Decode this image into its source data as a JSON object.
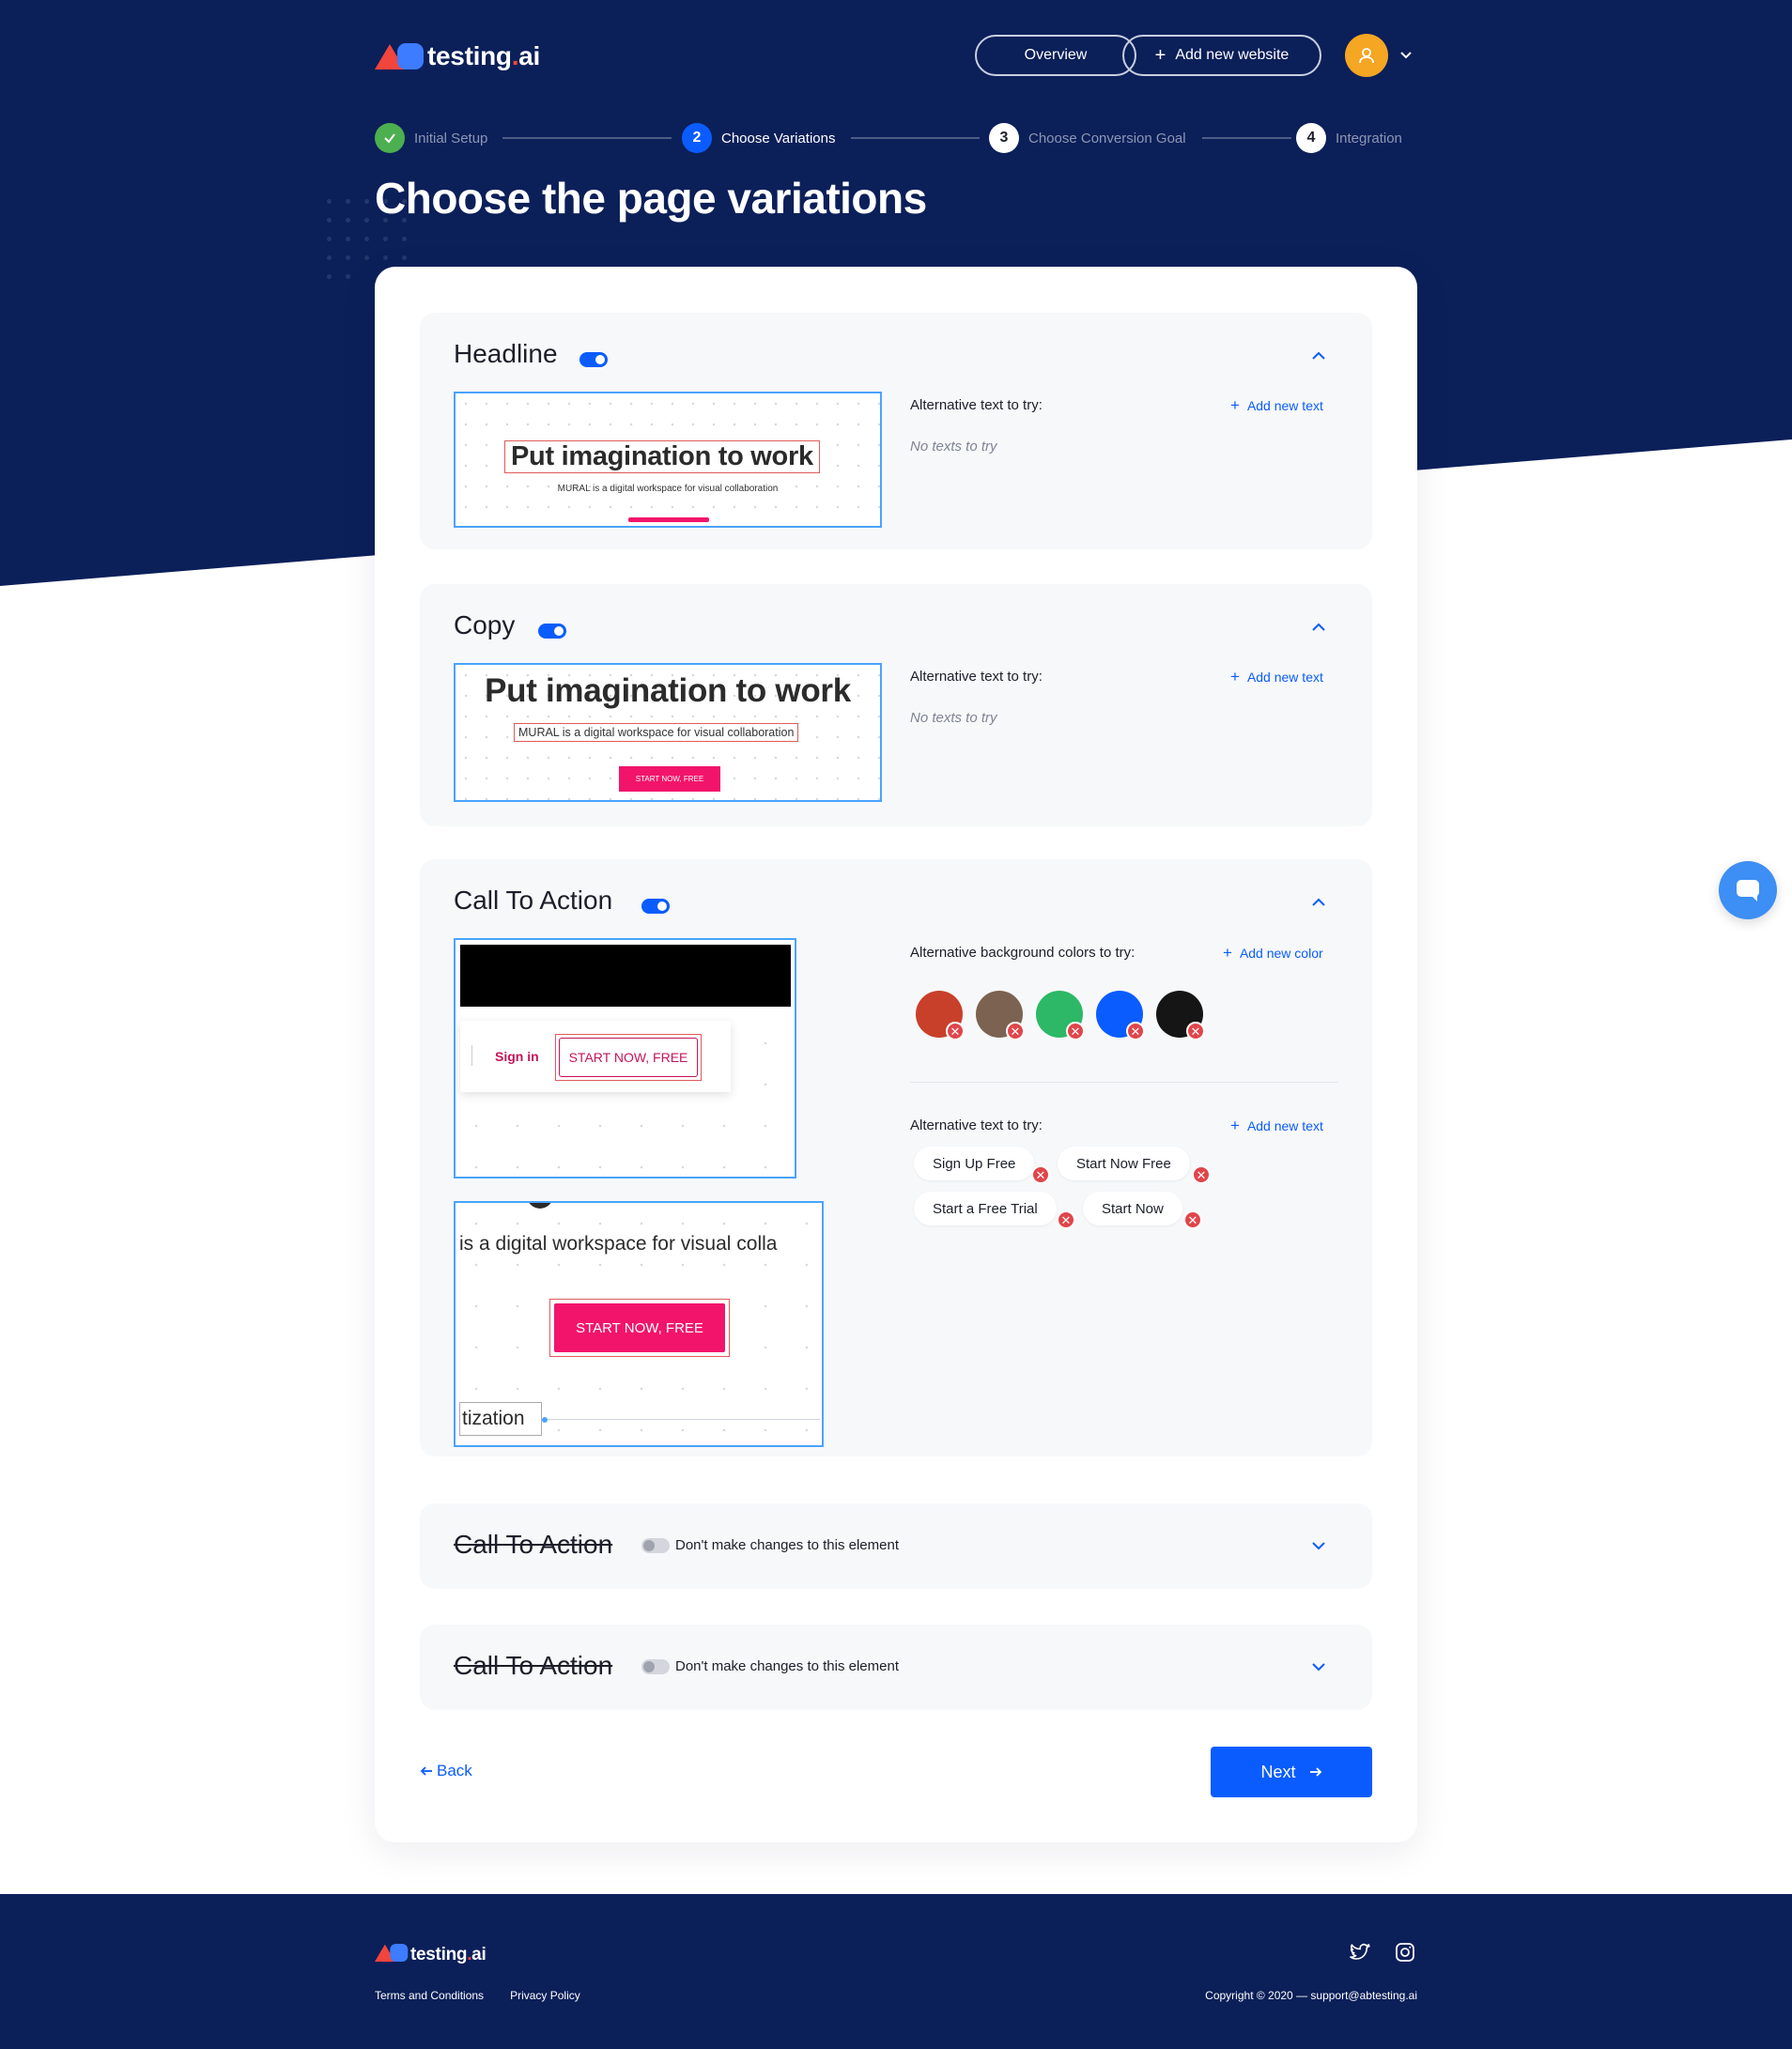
{
  "header": {
    "logo_text": "testing",
    "logo_dot": ".",
    "logo_suffix": "ai",
    "overview_label": "Overview",
    "add_website_label": "Add new website"
  },
  "stepper": {
    "steps": [
      {
        "number": "",
        "label": "Initial Setup",
        "state": "done"
      },
      {
        "number": "2",
        "label": "Choose Variations",
        "state": "active"
      },
      {
        "number": "3",
        "label": "Choose Conversion Goal",
        "state": "pending"
      },
      {
        "number": "4",
        "label": "Integration",
        "state": "pending"
      }
    ]
  },
  "page_title": "Choose the page variations",
  "sections": {
    "headline": {
      "title": "Headline",
      "enabled": true,
      "preview_heading": "Put imagination to work",
      "preview_sub": "MURAL is a digital workspace for visual collaboration",
      "alt_label": "Alternative text to try:",
      "add_label": "Add new text",
      "empty_label": "No texts to try"
    },
    "copy": {
      "title": "Copy",
      "enabled": true,
      "preview_heading": "Put imagination to work",
      "preview_sub": "MURAL is a digital workspace for visual collaboration",
      "preview_btn": "START NOW, FREE",
      "alt_label": "Alternative text to try:",
      "add_label": "Add new text",
      "empty_label": "No texts to try"
    },
    "cta": {
      "title": "Call To Action",
      "enabled": true,
      "preview1_signin": "Sign in",
      "preview1_btn": "START NOW, FREE",
      "preview2_text": "is a digital workspace for visual colla",
      "preview2_btn": "START NOW, FREE",
      "preview2_tail": "tization",
      "colors_label": "Alternative background colors to try:",
      "add_color_label": "Add new color",
      "colors": [
        "#c8402a",
        "#7b6251",
        "#2cb866",
        "#0a5cff",
        "#151515"
      ],
      "text_label": "Alternative text to try:",
      "add_text_label": "Add new text",
      "texts": [
        "Sign Up Free",
        "Start Now Free",
        "Start a Free Trial",
        "Start Now"
      ]
    },
    "cta_disabled_1": {
      "title": "Call To Action",
      "enabled": false,
      "note": "Don't make changes to this element"
    },
    "cta_disabled_2": {
      "title": "Call To Action",
      "enabled": false,
      "note": "Don't make changes to this element"
    }
  },
  "actions": {
    "back_label": "Back",
    "next_label": "Next"
  },
  "footer": {
    "logo_text": "testing",
    "logo_dot": ".",
    "logo_suffix": "ai",
    "terms_label": "Terms and Conditions",
    "privacy_label": "Privacy Policy",
    "copyright": "Copyright © 2020 — support@abtesting.ai"
  },
  "colors": {
    "navy": "#0b1f59",
    "accent": "#0a5cff",
    "success": "#4caf50",
    "brand_red": "#f2453d",
    "pink": "#f2146b"
  }
}
